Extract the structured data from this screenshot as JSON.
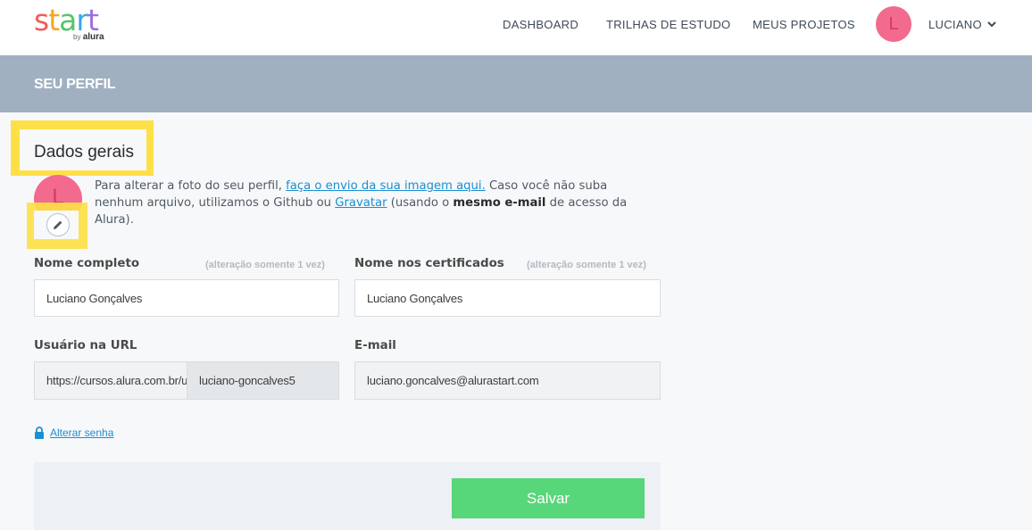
{
  "header": {
    "logo_letters": [
      "s",
      "t",
      "a",
      "r",
      "t"
    ],
    "logo_colors": [
      "#f25a5a",
      "#f5a623",
      "#57c46a",
      "#3aa6e8",
      "#a06de0"
    ],
    "logo_by": "by",
    "logo_brand": "alura",
    "nav": [
      {
        "label": "DASHBOARD"
      },
      {
        "label": "TRILHAS DE ESTUDO"
      },
      {
        "label": "MEUS PROJETOS"
      }
    ],
    "avatar_initial": "L",
    "user_name": "LUCIANO"
  },
  "banner": {
    "title": "SEU PERFIL"
  },
  "section": {
    "title": "Dados gerais"
  },
  "photo": {
    "avatar_initial": "L",
    "text_before": "Para alterar a foto do seu perfil, ",
    "link_upload": "faça o envio da sua imagem aqui.",
    "text_middle": " Caso você não suba nenhum arquivo, utilizamos o Github ou ",
    "link_gravatar": "Gravatar",
    "text_paren": " (usando o ",
    "bold_same_email": "mesmo e-mail",
    "text_after": " de acesso da Alura)."
  },
  "form": {
    "full_name": {
      "label": "Nome completo",
      "hint": "(alteração somente 1 vez)",
      "value": "Luciano Gonçalves"
    },
    "cert_name": {
      "label": "Nome nos certificados",
      "hint": "(alteração somente 1 vez)",
      "value": "Luciano Gonçalves"
    },
    "url_user": {
      "label": "Usuário na URL",
      "prefix": "https://cursos.alura.com.br/user/",
      "value": "luciano-goncalves5"
    },
    "email": {
      "label": "E-mail",
      "value": "luciano.goncalves@alurastart.com"
    }
  },
  "change_password": {
    "label": "Alterar senha"
  },
  "save": {
    "label": "Salvar"
  },
  "colors": {
    "accent_link": "#1b8fd0",
    "save_green": "#58d67a",
    "banner": "#a1b0c1",
    "highlight": "#fde048",
    "avatar": "#f26a8d"
  }
}
